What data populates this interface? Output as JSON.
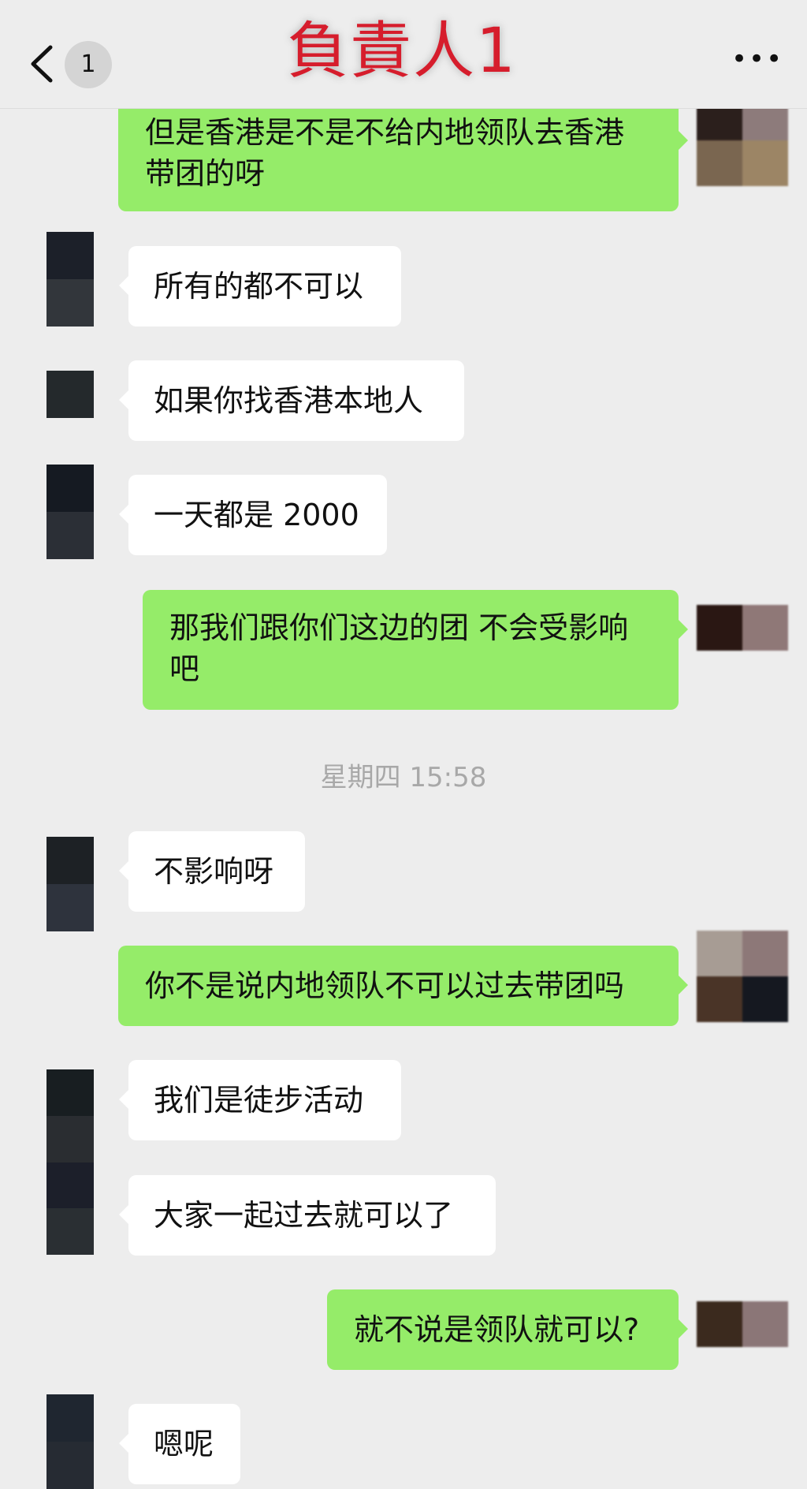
{
  "header": {
    "title": "負責人1",
    "unread_count": "1",
    "more_label": "•••"
  },
  "timestamp": "星期四 15:58",
  "messages": [
    {
      "side": "out",
      "text": "但是香港是不是不给内地领队去香港带团的呀"
    },
    {
      "side": "in",
      "text": "所有的都不可以"
    },
    {
      "side": "in",
      "text": "如果你找香港本地人"
    },
    {
      "side": "in",
      "text": "一天都是 2000"
    },
    {
      "side": "out",
      "text": "那我们跟你们这边的团 不会受影响吧"
    },
    {
      "side": "in",
      "text": "不影响呀"
    },
    {
      "side": "out",
      "text": "你不是说内地领队不可以过去带团吗"
    },
    {
      "side": "in",
      "text": "我们是徒步活动"
    },
    {
      "side": "in",
      "text": "大家一起过去就可以了"
    },
    {
      "side": "out",
      "text": "就不说是领队就可以?"
    },
    {
      "side": "in",
      "text": "嗯呢"
    }
  ],
  "colors": {
    "background": "#ededed",
    "incoming_bubble": "#ffffff",
    "outgoing_bubble": "#95ec69",
    "title": "#d61d2c"
  }
}
